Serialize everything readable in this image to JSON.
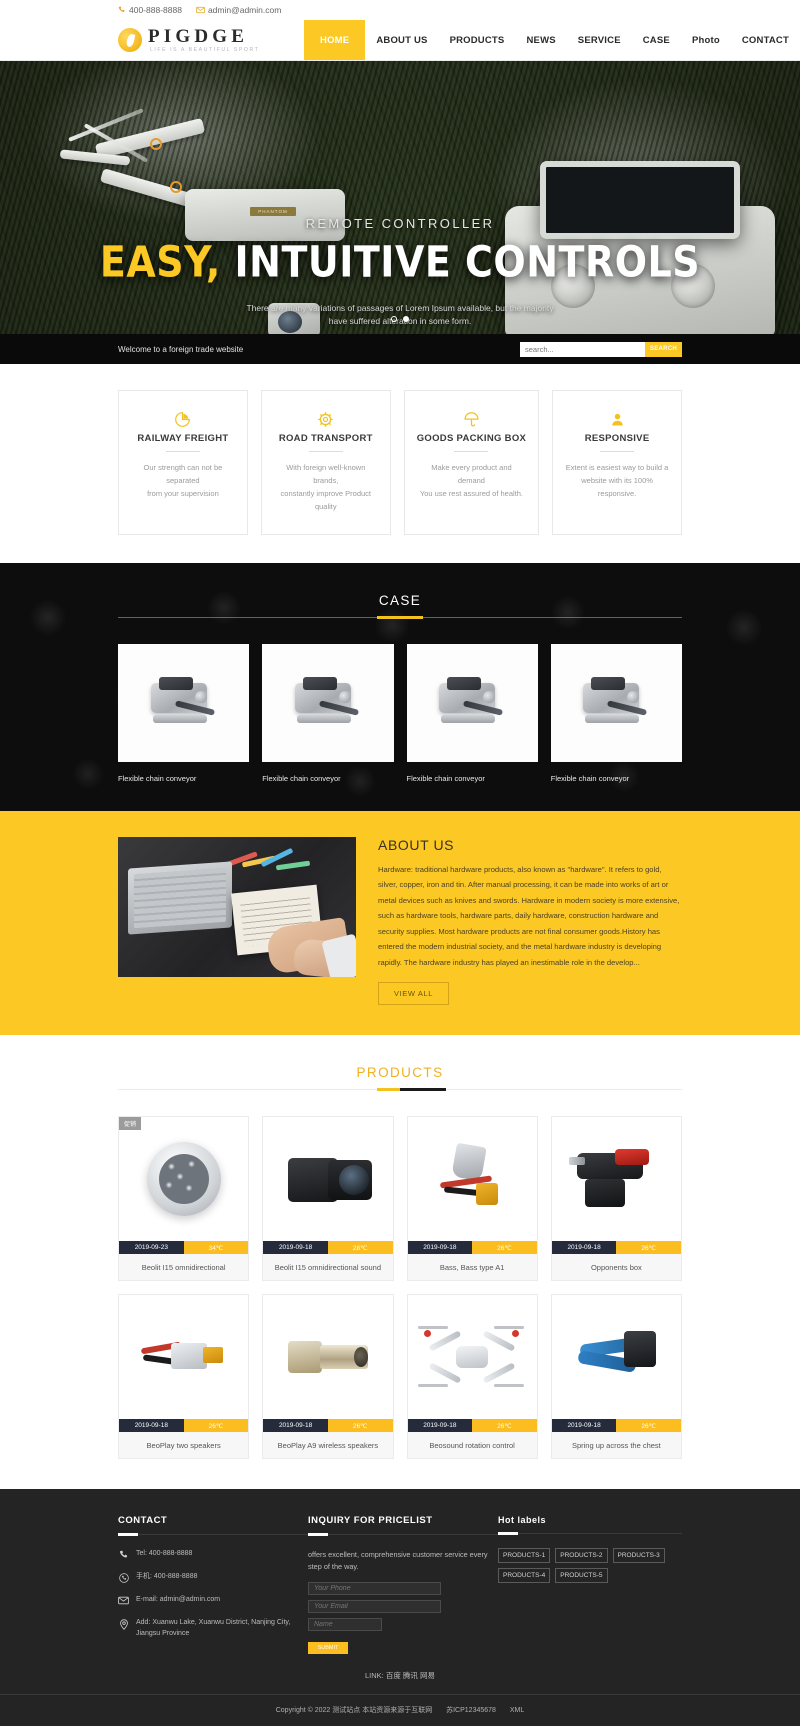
{
  "topbar": {
    "phone": "400-888-8888",
    "email": "admin@admin.com",
    "phone_icon": "phone-icon",
    "email_icon": "envelope-icon"
  },
  "brand": {
    "name": "PIGDGE",
    "tagline": "LIFE IS A BEAUTIFUL SPORT",
    "logo_icon": "flame-logo-icon"
  },
  "nav": {
    "items": [
      {
        "label": "HOME",
        "active": true
      },
      {
        "label": "ABOUT US",
        "active": false
      },
      {
        "label": "PRODUCTS",
        "active": false
      },
      {
        "label": "NEWS",
        "active": false
      },
      {
        "label": "SERVICE",
        "active": false
      },
      {
        "label": "CASE",
        "active": false
      },
      {
        "label": "Photo",
        "active": false
      },
      {
        "label": "CONTACT",
        "active": false
      }
    ]
  },
  "hero": {
    "kicker": "REMOTE CONTROLLER",
    "title_highlight": "EASY,",
    "title_rest": "INTUITIVE CONTROLS",
    "description_line1": "There are many variations of passages of Lorem Ipsum available, but the majority",
    "description_line2": "have suffered alteration in some form.",
    "dots": [
      {
        "active": false
      },
      {
        "active": true
      }
    ]
  },
  "welcome": {
    "text": "Welcome to a foreign trade website",
    "search_placeholder": "search...",
    "search_value": "",
    "search_button": "SEARCH"
  },
  "features": [
    {
      "icon": "pie-chart-icon",
      "title": "RAILWAY FREIGHT",
      "desc_line1": "Our strength can not be separated",
      "desc_line2": "from your supervision"
    },
    {
      "icon": "gear-icon",
      "title": "ROAD TRANSPORT",
      "desc_line1": "With foreign well-known brands,",
      "desc_line2": "constantly improve Product quality"
    },
    {
      "icon": "umbrella-icon",
      "title": "GOODS PACKING BOX",
      "desc_line1": "Make every product and demand",
      "desc_line2": "You use rest assured of health."
    },
    {
      "icon": "user-icon",
      "title": "RESPONSIVE",
      "desc_line1": "Extent is easiest way to build a",
      "desc_line2": "website with its 100% responsive."
    }
  ],
  "case": {
    "heading": "CASE",
    "cards": [
      {
        "caption": "Flexible chain conveyor"
      },
      {
        "caption": "Flexible chain conveyor"
      },
      {
        "caption": "Flexible chain conveyor"
      },
      {
        "caption": "Flexible chain conveyor"
      }
    ]
  },
  "about": {
    "title": "ABOUT US",
    "body": "Hardware: traditional hardware products, also known as \"hardware\". It refers to gold, silver, copper, iron and tin. After manual processing, it can be made into works of art or metal devices such as knives and swords. Hardware in modern society is more extensive, such as hardware tools, hardware parts, daily hardware, construction hardware and security supplies. Most hardware products are not final consumer goods.History has entered the modern industrial society, and the metal hardware industry is developing rapidly. The hardware industry has played an inestimable role in the develop...",
    "button": "VIEW ALL",
    "image_alt": "desk-with-laptop-notebook-and-hands"
  },
  "products": {
    "heading": "PRODUCTS",
    "rows": [
      [
        {
          "badge": "促销",
          "date": "2019-09-23",
          "temp": "34℃",
          "name": "Beolit I15 omnidirectional",
          "illustration": "led-floodlight"
        },
        {
          "badge": "",
          "date": "2019-09-18",
          "temp": "28℃",
          "name": "Beolit I15 omnidirectional sound",
          "illustration": "dslr-camera"
        },
        {
          "badge": "",
          "date": "2019-09-18",
          "temp": "26℃",
          "name": "Bass, Bass type A1",
          "illustration": "wire-tool"
        },
        {
          "badge": "",
          "date": "2019-09-18",
          "temp": "26℃",
          "name": "Opponents box",
          "illustration": "cordless-drill"
        }
      ],
      [
        {
          "badge": "",
          "date": "2019-09-18",
          "temp": "26℃",
          "name": "BeoPlay two speakers",
          "illustration": "wire-connector"
        },
        {
          "badge": "",
          "date": "2019-09-18",
          "temp": "26℃",
          "name": "BeoPlay A9 wireless speakers",
          "illustration": "brass-fitting"
        },
        {
          "badge": "",
          "date": "2019-09-18",
          "temp": "26℃",
          "name": "Beosound rotation control",
          "illustration": "quadcopter-drone"
        },
        {
          "badge": "",
          "date": "2019-09-18",
          "temp": "26℃",
          "name": "Spring up across the chest",
          "illustration": "crimping-tool"
        }
      ]
    ]
  },
  "footer": {
    "contact": {
      "title": "CONTACT",
      "items": [
        {
          "icon": "phone-icon",
          "text": "Tel:  400-888-8888"
        },
        {
          "icon": "whatsapp-icon",
          "text": "手机:  400-888-8888"
        },
        {
          "icon": "envelope-icon",
          "text": "E-mail: admin@admin.com"
        },
        {
          "icon": "location-pin-icon",
          "text": "Add:  Xuanwu Lake, Xuanwu District, Nanjing City, Jiangsu Province"
        }
      ]
    },
    "inquiry": {
      "title": "INQUIRY FOR PRICELIST",
      "note": "offers excellent, comprehensive customer service every step of the way.",
      "phone_placeholder": "Your Phone",
      "email_placeholder": "Your Email",
      "name_placeholder": "Name",
      "submit_label": "SUBMIT"
    },
    "hot": {
      "title": "Hot labels",
      "tags": [
        "PRODUCTS-1",
        "PRODUCTS-2",
        "PRODUCTS-3",
        "PRODUCTS-4",
        "PRODUCTS-5"
      ]
    },
    "links": {
      "label": "LINK:",
      "items": [
        "百度",
        "腾讯",
        "网易"
      ]
    },
    "copyright": "Copyright © 2022 测试站点 本站资源来源于互联网",
    "icp": "苏ICP12345678",
    "xml": "XML"
  },
  "colors": {
    "accent": "#fbc824",
    "accent_dark": "#f2b01e",
    "dark": "#242424",
    "meta_dark": "#262b3c",
    "meta_amber": "#fbbd20"
  }
}
